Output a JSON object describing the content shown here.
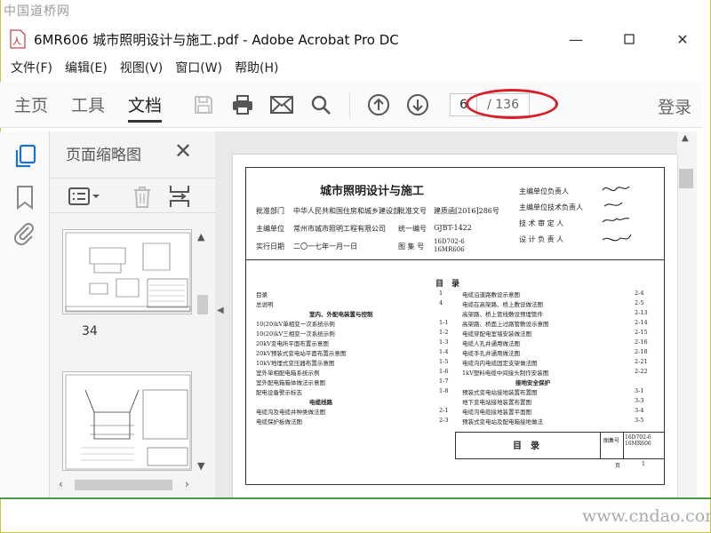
{
  "watermark_top": "中国道桥网",
  "watermark_bottom": "www.cndao.com",
  "window": {
    "title": "6MR606 城市照明设计与施工.pdf - Adobe Acrobat Pro DC"
  },
  "menu": [
    "文件(F)",
    "编辑(E)",
    "视图(V)",
    "窗口(W)",
    "帮助(H)"
  ],
  "toolbar": {
    "tabs": [
      "主页",
      "工具",
      "文档"
    ],
    "active_tab": "文档",
    "page_current": "6",
    "page_total": "/ 136",
    "login": "登录"
  },
  "panel": {
    "title": "页面缩略图",
    "thumb_page_label": "34"
  },
  "doc": {
    "title": "城市照明设计与施工",
    "meta": [
      [
        "批准部门",
        "中华人民共和国住房和城乡建设部",
        "批准文号",
        "建质函[2016]286号"
      ],
      [
        "主编单位",
        "常州市城市照明工程有限公司",
        "统一编号",
        "GJBT-1422"
      ],
      [
        "实行日期",
        "二〇一七年一月一日",
        "图 集 号",
        "16D702-6 16MR606"
      ]
    ],
    "roles": [
      "主编单位负责人",
      "主编单位技术负责人",
      "技 术 审 定 人",
      "设 计 负 责 人"
    ],
    "toc_heading": "目　录",
    "toc_left": [
      [
        "目录",
        "1"
      ],
      [
        "总说明",
        "4"
      ],
      [
        "室内、外配电装置与控制",
        ""
      ],
      [
        "10(20)kV单相变一次系统示例",
        "1-1"
      ],
      [
        "10(20)kV三相变一次系统示例",
        "1-2"
      ],
      [
        "20kV变电所平面布置示意图",
        "1-3"
      ],
      [
        "20kV预装式变电站平面布置示意图",
        "1-4"
      ],
      [
        "10kV地埋式变压器布置示意图",
        "1-5"
      ],
      [
        "室外单相配电箱系统示例",
        "1-6"
      ],
      [
        "室外配电箱箱体做法示意图",
        "1-7"
      ],
      [
        "配电设备警示标志",
        "1-8"
      ],
      [
        "电缆线路",
        ""
      ],
      [
        "电缆沟及电缆井种类做法图",
        "2-1"
      ],
      [
        "电缆保护板做法图",
        "2-3"
      ]
    ],
    "toc_right": [
      [
        "电缆沿道路敷设示意图",
        "2-4"
      ],
      [
        "电缆在高架路、桥上敷设做法图",
        "2-5"
      ],
      [
        "高架路、桥上管线敷设预埋管件",
        "2-13"
      ],
      [
        "高架路、桥面上过路管敷设示意图",
        "2-14"
      ],
      [
        "电缆穿配电室墙安装做法图",
        "2-15"
      ],
      [
        "电缆人孔井通用做法图",
        "2-16"
      ],
      [
        "电缆手孔井通用做法图",
        "2-18"
      ],
      [
        "电缆沟内电缆固定支架做法图",
        "2-21"
      ],
      [
        "1kV塑料电缆中间接头制作安装图",
        "2-22"
      ],
      [
        "接地安全保护",
        ""
      ],
      [
        "预装式变电站接地装置布置图",
        "3-1"
      ],
      [
        "地下变电站接地装置布置图",
        "3-3"
      ],
      [
        "电缆沟电缆接地装置平面图",
        "3-4"
      ],
      [
        "预装式变电站及配电箱接地做法",
        "3-5"
      ]
    ],
    "titleblock": {
      "name": "目　录",
      "label": "图集号",
      "code": "16D702-6 16MR606",
      "page_label": "页",
      "page": "1"
    }
  }
}
